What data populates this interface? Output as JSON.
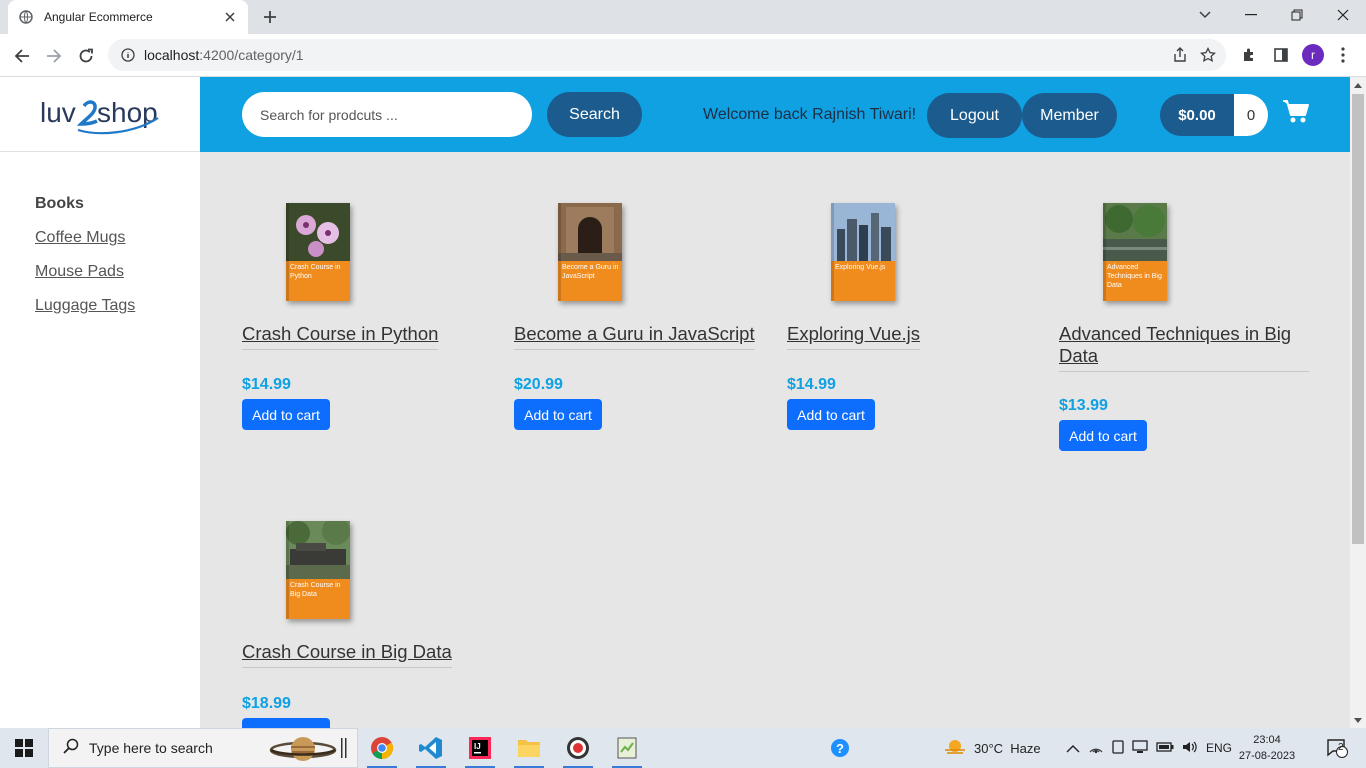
{
  "browser": {
    "tab_title": "Angular Ecommerce",
    "url_host": "localhost",
    "url_path": ":4200/category/1",
    "profile_initial": "r"
  },
  "sidebar": {
    "logo_text": "luv2shop",
    "categories": [
      {
        "label": "Books",
        "active": true
      },
      {
        "label": "Coffee Mugs",
        "active": false
      },
      {
        "label": "Mouse Pads",
        "active": false
      },
      {
        "label": "Luggage Tags",
        "active": false
      }
    ]
  },
  "header": {
    "search_placeholder": "Search for prodcuts ...",
    "search_button": "Search",
    "welcome": "Welcome back Rajnish Tiwari!",
    "logout_button": "Logout",
    "member_button": "Member",
    "cart_total": "$0.00",
    "cart_quantity": "0"
  },
  "products": [
    {
      "title": "Crash Course in Python",
      "price": "$14.99",
      "cover_text": "Crash Course in Python",
      "button": "Add to cart"
    },
    {
      "title": "Become a Guru in JavaScript",
      "price": "$20.99",
      "cover_text": "Become a Guru in JavaScript",
      "button": "Add to cart"
    },
    {
      "title": "Exploring Vue.js",
      "price": "$14.99",
      "cover_text": "Exploring Vue.js",
      "button": "Add to cart"
    },
    {
      "title": "Advanced Techniques in Big Data",
      "price": "$13.99",
      "cover_text": "Advanced Techniques in Big Data",
      "button": "Add to cart"
    },
    {
      "title": "Crash Course in Big Data",
      "price": "$18.99",
      "cover_text": "Crash Course in Big Data",
      "button": "Add to cart"
    }
  ],
  "taskbar": {
    "search_text": "Type here to search",
    "weather": "30°C  Haze",
    "language": "ENG",
    "time": "23:04",
    "date": "27-08-2023",
    "notifications": "2"
  },
  "colors": {
    "header_blue": "#10a1e3",
    "pill_blue": "#1b5b8e",
    "button_blue": "#0d6efd"
  }
}
